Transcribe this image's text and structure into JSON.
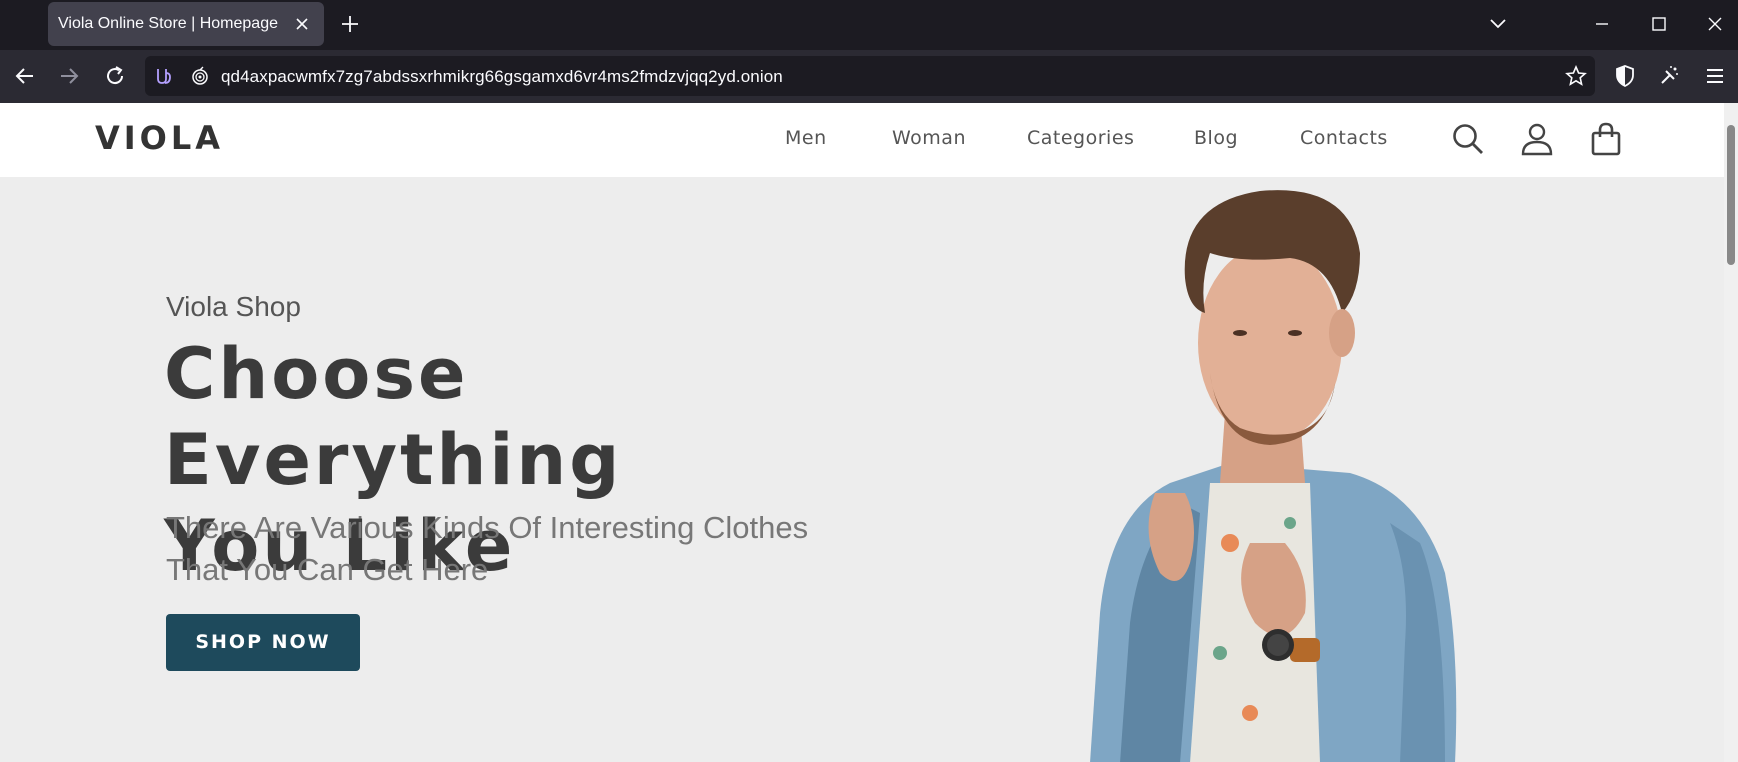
{
  "browser": {
    "tab_title": "Viola Online Store | Homepage",
    "url": "qd4axpacwmfx7zg7abdssxrhmikrg66gsgamxd6vr4ms2fmdzvjqq2yd.onion"
  },
  "header": {
    "logo": "VIOLA",
    "menu": [
      "Men",
      "Woman",
      "Categories",
      "Blog",
      "Contacts"
    ]
  },
  "hero": {
    "subtitle": "Viola Shop",
    "title_line1": "Choose Everything",
    "title_line2": "You Like",
    "description": "There Are Various Kinds Of Interesting Clothes That You Can Get Here",
    "cta": "SHOP NOW"
  },
  "colors": {
    "cta_bg": "#1e4a5c",
    "page_bg": "#ededed",
    "chrome_bg": "#1c1b22"
  },
  "icons": [
    "close-icon",
    "plus-icon",
    "chevron-down-icon",
    "minimize-icon",
    "maximize-icon",
    "back-icon",
    "forward-icon",
    "reload-icon",
    "onion-icon",
    "star-icon",
    "shield-icon",
    "extension-icon",
    "menu-icon",
    "search-icon",
    "user-icon",
    "shopping-bag-icon"
  ]
}
